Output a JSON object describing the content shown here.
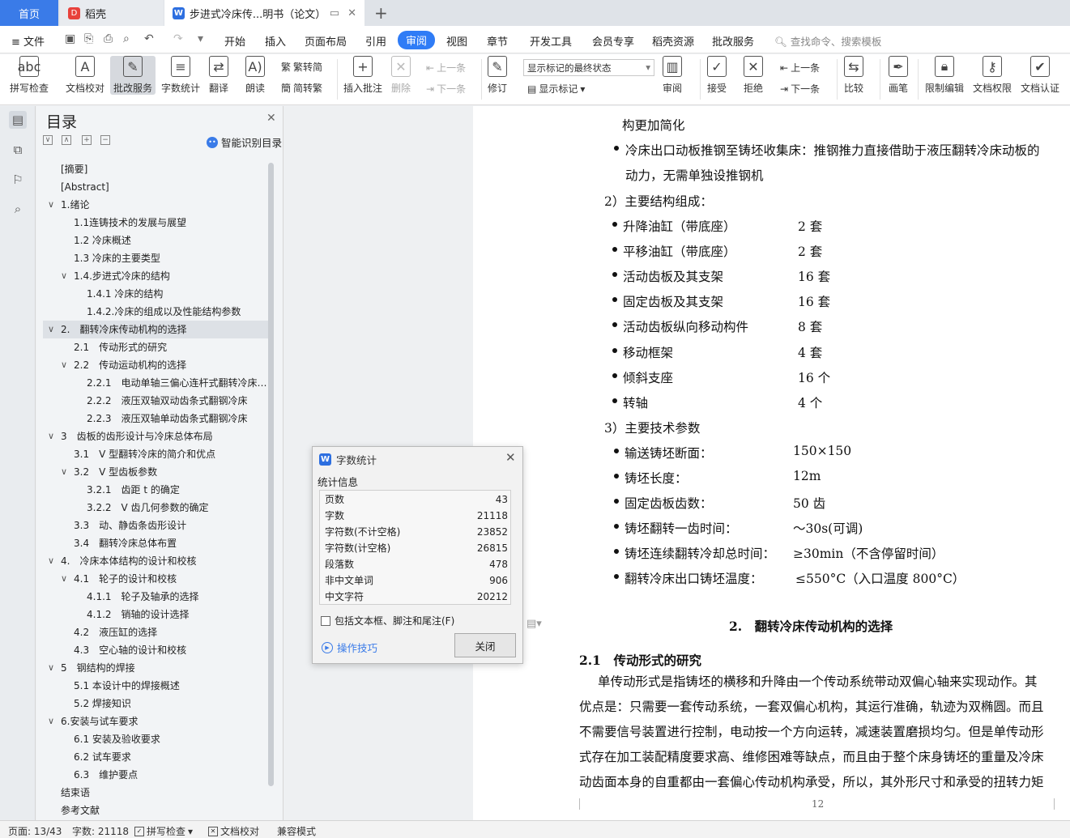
{
  "tabs": {
    "home": "首页",
    "daoke": "稻壳",
    "doc": "步进式冷床传...明书（论文）",
    "add": "+"
  },
  "menu": {
    "file": "文件",
    "items": [
      "开始",
      "插入",
      "页面布局",
      "引用",
      "审阅",
      "视图",
      "章节",
      "开发工具",
      "会员专享",
      "稻壳资源",
      "批改服务"
    ],
    "search": "查找命令、搜索模板"
  },
  "ribbon": {
    "spell": "拼写检查",
    "proofread": "文档校对",
    "correct": "批改服务",
    "wordcount": "字数统计",
    "translate": "翻译",
    "read": "朗读",
    "to_trad": "繁转简",
    "to_simp": "简转繁",
    "add_comment": "插入批注",
    "delete": "删除",
    "prev_comment": "上一条",
    "next_comment": "下一条",
    "track": "修订",
    "markup_state": "显示标记的最终状态",
    "show_markup": "显示标记",
    "review_pane": "审阅",
    "accept": "接受",
    "reject": "拒绝",
    "prev_change": "上一条",
    "next_change": "下一条",
    "compare": "比较",
    "pen": "画笔",
    "restrict": "限制编辑",
    "permission": "文档权限",
    "certify": "文档认证"
  },
  "nav": {
    "title": "目录",
    "smart": "智能识别目录",
    "toc": [
      {
        "t": "[摘要]",
        "l": 1
      },
      {
        "t": "[Abstract]",
        "l": 1
      },
      {
        "t": "1.绪论",
        "l": 0,
        "c": "∨"
      },
      {
        "t": "1.1连铸技术的发展与展望",
        "l": 2
      },
      {
        "t": "1.2 冷床概述",
        "l": 2
      },
      {
        "t": "1.3 冷床的主要类型",
        "l": 2
      },
      {
        "t": "1.4.步进式冷床的结构",
        "l": 1,
        "c": "∨"
      },
      {
        "t": "1.4.1 冷床的结构",
        "l": 3
      },
      {
        "t": "1.4.2.冷床的组成以及性能结构参数",
        "l": 3
      },
      {
        "t": "2.　翻转冷床传动机构的选择",
        "l": 0,
        "c": "∨",
        "a": true
      },
      {
        "t": "2.1　传动形式的研究",
        "l": 2
      },
      {
        "t": "2.2　传动运动机构的选择",
        "l": 1,
        "c": "∨"
      },
      {
        "t": "2.2.1　电动单轴三偏心连杆式翻转冷床的...",
        "l": 3
      },
      {
        "t": "2.2.2　液压双轴双动齿条式翻钢冷床",
        "l": 3
      },
      {
        "t": "2.2.3　液压双轴单动齿条式翻钢冷床",
        "l": 3
      },
      {
        "t": "3　齿板的齿形设计与冷床总体布局",
        "l": 0,
        "c": "∨"
      },
      {
        "t": "3.1　V 型翻转冷床的简介和优点",
        "l": 2
      },
      {
        "t": "3.2　V 型齿板参数",
        "l": 1,
        "c": "∨"
      },
      {
        "t": "3.2.1　齿距 t 的确定",
        "l": 3
      },
      {
        "t": "3.2.2　V 齿几何参数的确定",
        "l": 3
      },
      {
        "t": "3.3　动、静齿条齿形设计",
        "l": 2
      },
      {
        "t": "3.4　翻转冷床总体布置",
        "l": 2
      },
      {
        "t": "4.　冷床本体结构的设计和校核",
        "l": 0,
        "c": "∨"
      },
      {
        "t": "4.1　轮子的设计和校核",
        "l": 1,
        "c": "∨"
      },
      {
        "t": "4.1.1　轮子及轴承的选择",
        "l": 3
      },
      {
        "t": "4.1.2　销轴的设计选择",
        "l": 3
      },
      {
        "t": "4.2　液压缸的选择",
        "l": 2
      },
      {
        "t": "4.3　空心轴的设计和校核",
        "l": 2
      },
      {
        "t": "5　钢结构的焊接",
        "l": 0,
        "c": "∨"
      },
      {
        "t": "5.1 本设计中的焊接概述",
        "l": 2
      },
      {
        "t": "5.2 焊接知识",
        "l": 2
      },
      {
        "t": "6.安装与试车要求",
        "l": 0,
        "c": "∨"
      },
      {
        "t": "6.1 安装及验收要求",
        "l": 2
      },
      {
        "t": "6.2 试车要求",
        "l": 2
      },
      {
        "t": "6.3　维护要点",
        "l": 2
      },
      {
        "t": "结束语",
        "l": 1
      },
      {
        "t": "参考文献",
        "l": 1
      }
    ]
  },
  "doc": {
    "line0": "构更加简化",
    "b1a": "冷床出口动板推钢至铸坯收集床：推钢推力直接借助于液压翻转冷床动板的",
    "b1b": "动力，无需单独设推钢机",
    "sec2": "2）主要结构组成：",
    "parts": [
      [
        "升降油缸（带底座）",
        "2 套"
      ],
      [
        "平移油缸（带底座）",
        "2 套"
      ],
      [
        "活动齿板及其支架",
        "16 套"
      ],
      [
        "固定齿板及其支架",
        "16 套"
      ],
      [
        "活动齿板纵向移动构件",
        "8 套"
      ],
      [
        "移动框架",
        "4 套"
      ],
      [
        "倾斜支座",
        "16 个"
      ],
      [
        "转轴",
        "4 个"
      ]
    ],
    "sec3": "3）主要技术参数",
    "params": [
      [
        "输送铸坯断面：",
        "150×150"
      ],
      [
        "铸坯长度：",
        "12m"
      ],
      [
        "固定齿板齿数：",
        "50 齿"
      ],
      [
        "铸坯翻转一齿时间：",
        "～30s(可调)"
      ],
      [
        "铸坯连续翻转冷却总时间：",
        "≥30min（不含停留时间）"
      ],
      [
        "翻转冷床出口铸坯温度：",
        "≤550°C（入口温度 800°C）"
      ]
    ],
    "chapter": "2.　翻转冷床传动机构的选择",
    "section": "2.1　传动形式的研究",
    "p1": "单传动形式是指铸坯的横移和升降由一个传动系统带动双偏心轴来实现动作。其",
    "p2": "优点是：只需要一套传动系统，一套双偏心机构，其运行准确，轨迹为双椭圆。而且",
    "p3": "不需要信号装置进行控制，电动按一个方向运转，减速装置磨损均匀。但是单传动形",
    "p4": "式存在加工装配精度要求高、维修困难等缺点，而且由于整个床身铸坯的重量及冷床",
    "p5": "动齿面本身的自重都由一套偏心传动机构承受，所以，其外形尺寸和承受的扭转力矩",
    "page_number": "12"
  },
  "dialog": {
    "title": "字数统计",
    "group": "统计信息",
    "stats": [
      [
        "页数",
        "43"
      ],
      [
        "字数",
        "21118"
      ],
      [
        "字符数(不计空格)",
        "23852"
      ],
      [
        "字符数(计空格)",
        "26815"
      ],
      [
        "段落数",
        "478"
      ],
      [
        "非中文单词",
        "906"
      ],
      [
        "中文字符",
        "20212"
      ]
    ],
    "checkbox": "包括文本框、脚注和尾注(F)",
    "tips": "操作技巧",
    "close": "关闭"
  },
  "status": {
    "page": "页面: 13/43",
    "words": "字数: 21118",
    "spell": "拼写检查",
    "proof": "文档校对",
    "compat": "兼容模式"
  }
}
